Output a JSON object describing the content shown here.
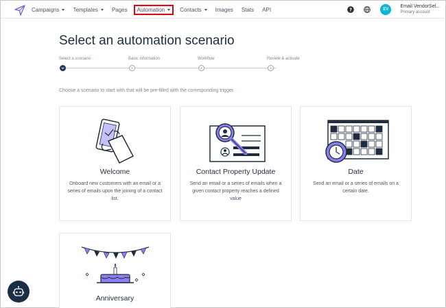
{
  "nav": {
    "items": [
      {
        "label": "Campaigns",
        "dropdown": true
      },
      {
        "label": "Templates",
        "dropdown": true
      },
      {
        "label": "Pages",
        "dropdown": false
      },
      {
        "label": "Automation",
        "dropdown": true,
        "highlighted": true
      },
      {
        "label": "Contacts",
        "dropdown": true
      },
      {
        "label": "Images",
        "dropdown": false
      },
      {
        "label": "Stats",
        "dropdown": false
      },
      {
        "label": "API",
        "dropdown": false
      }
    ],
    "help_icon": "help-circle-icon",
    "language_icon": "globe-icon"
  },
  "account": {
    "avatar_initials": "EV",
    "name": "Email VendorSel...",
    "role": "Primary account"
  },
  "page": {
    "title": "Select an automation scenario",
    "subtitle": "Choose a scenario to start with that will be pre-filled with the corresponding trigger."
  },
  "steps": [
    {
      "label": "Select a scenario",
      "active": true
    },
    {
      "label": "Basic information",
      "active": false
    },
    {
      "label": "Workflow",
      "active": false
    },
    {
      "label": "Review & activate",
      "active": false
    }
  ],
  "scenarios": {
    "welcome": {
      "title": "Welcome",
      "description": "Onboard new customers with an email or a series of emails upon the joining of a contact list."
    },
    "contact_property": {
      "title": "Contact Property Update",
      "description": "Send an email or a series of emails when a given contact property reaches a defined value"
    },
    "date": {
      "title": "Date",
      "description": "Send an email or a series of emails on a certain date."
    },
    "anniversary": {
      "title": "Anniversary",
      "description": ""
    }
  },
  "colors": {
    "accent": "#0bb5d6",
    "illustration_purple": "#8b7ff0",
    "dark": "#1f2d3d",
    "highlight_border": "#e8000b"
  }
}
